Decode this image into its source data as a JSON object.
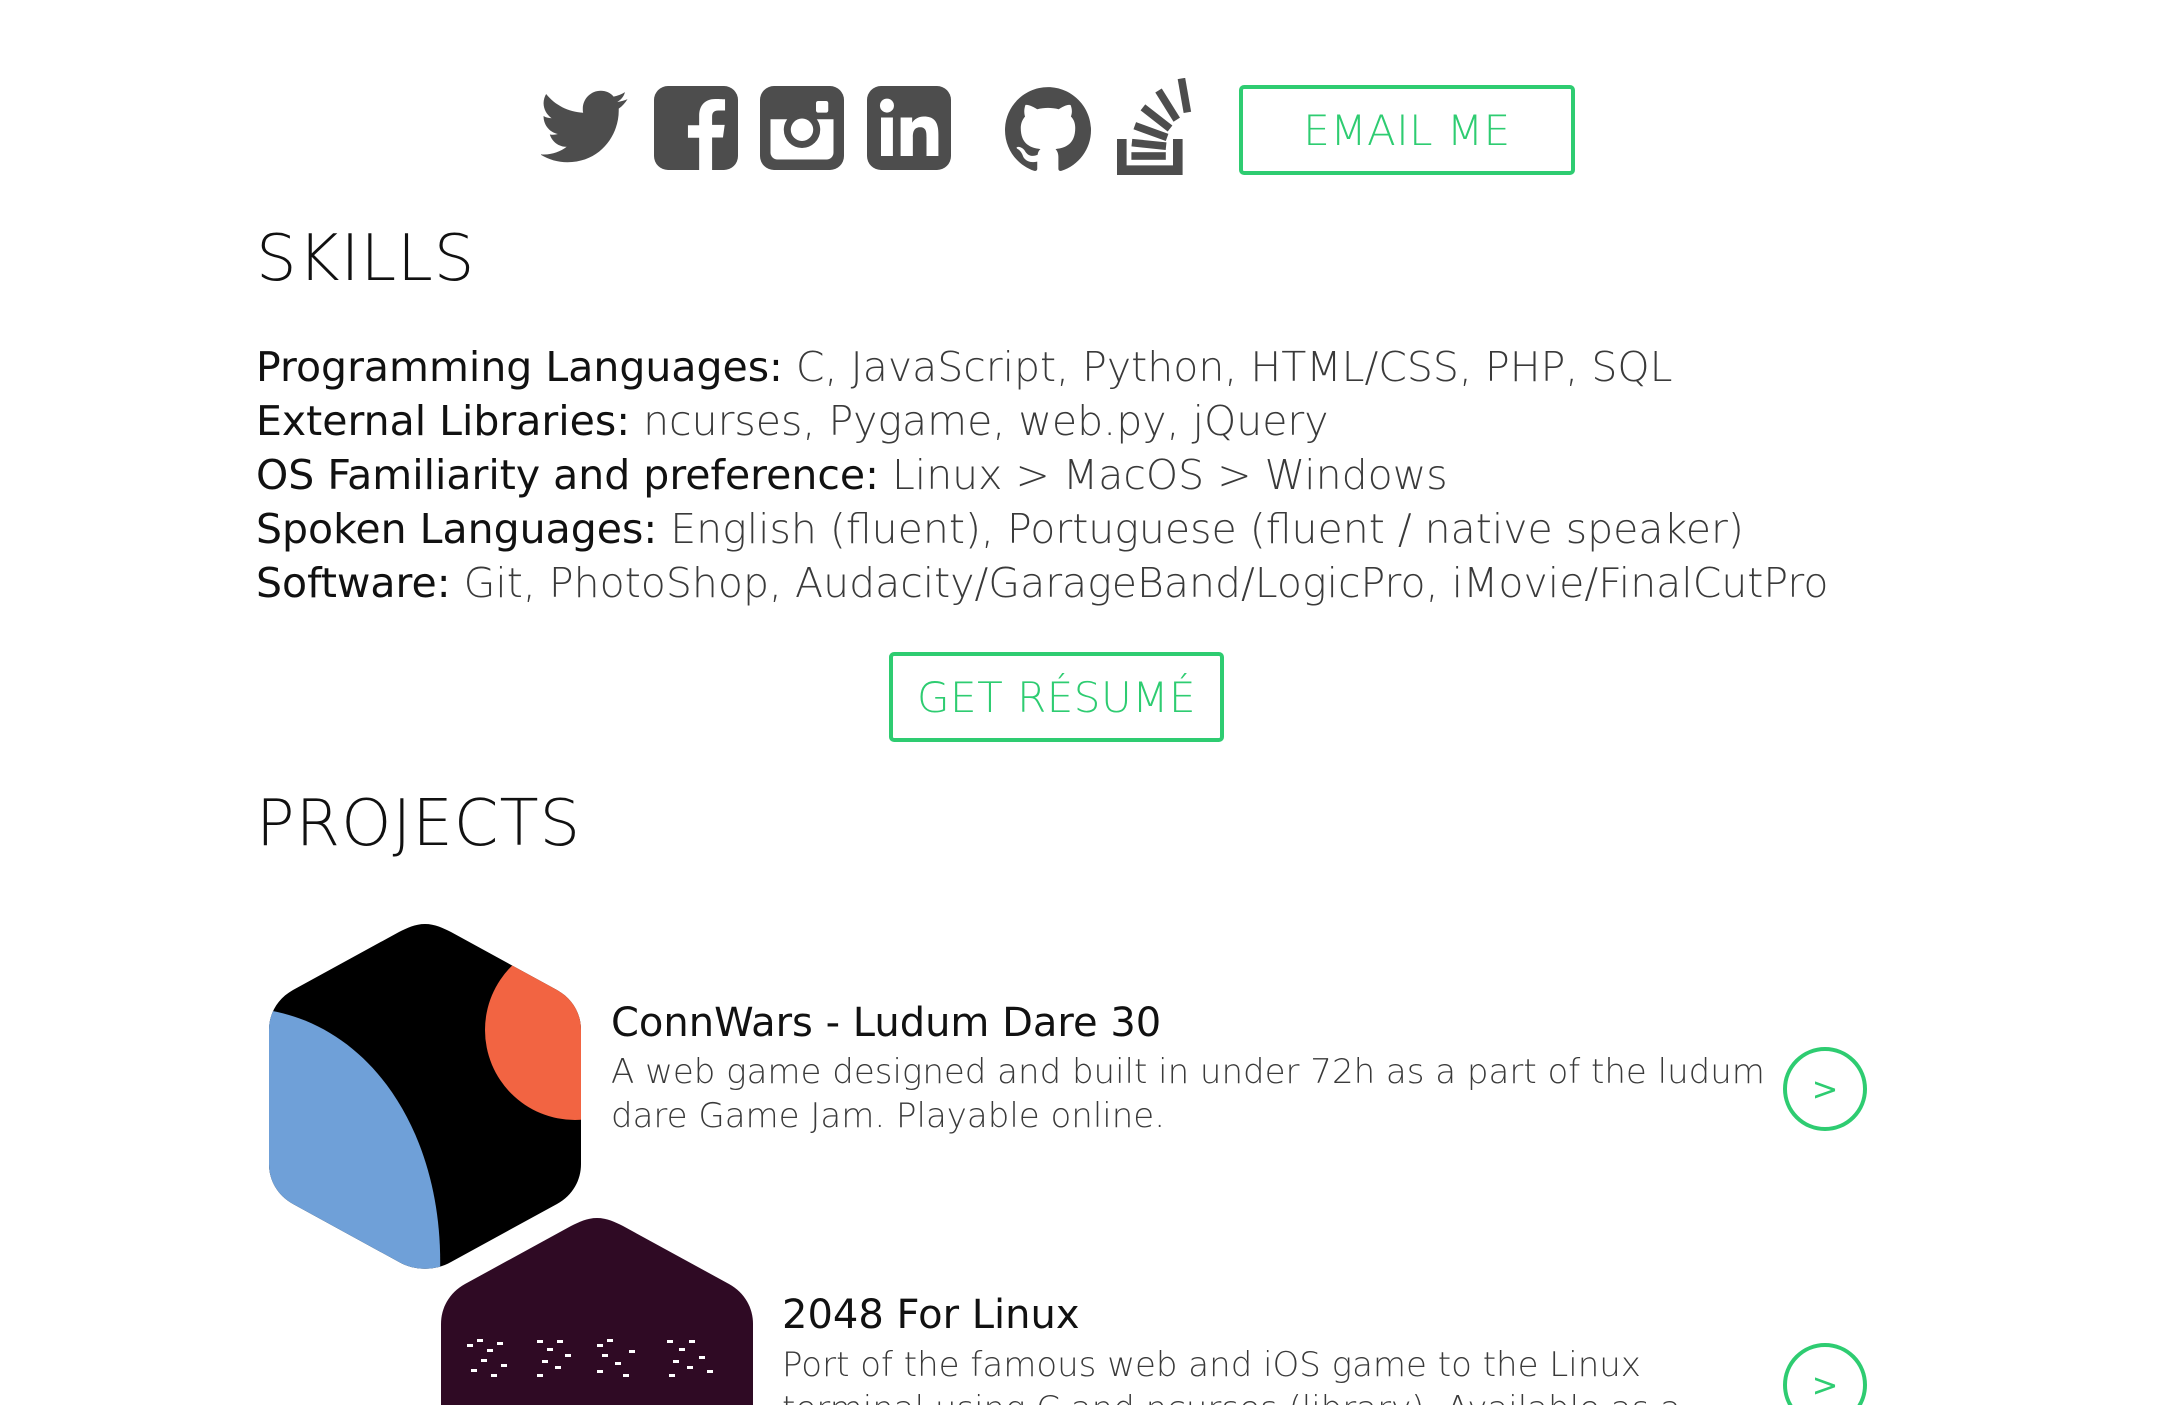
{
  "social": {
    "icons": [
      "twitter-icon",
      "facebook-icon",
      "instagram-icon",
      "linkedin-icon",
      "github-icon",
      "stackoverflow-icon"
    ],
    "icon_color": "#4d4d4d",
    "email_label": "EMAIL ME"
  },
  "accent_color": "#2ecc71",
  "skills": {
    "title": "SKILLS",
    "items": [
      {
        "label": "Programming Languages:",
        "value": " C, JavaScript, Python, HTML/CSS, PHP, SQL"
      },
      {
        "label": "External Libraries:",
        "value": " ncurses, Pygame, web.py, jQuery"
      },
      {
        "label": "OS Familiarity and preference:",
        "value": " Linux > MacOS > Windows"
      },
      {
        "label": "Spoken Languages:",
        "value": " English (fluent), Portuguese (fluent / native speaker)"
      },
      {
        "label": "Software:",
        "value": " Git, PhotoShop, Audacity/GarageBand/LogicPro, iMovie/FinalCutPro"
      }
    ],
    "resume_label": "GET RÉSUMÉ"
  },
  "projects": {
    "title": "PROJECTS",
    "items": [
      {
        "name": "ConnWars - Ludum Dare 30",
        "description": "A web game designed and built in under 72h as a part of the ludum dare Game Jam. Playable online.",
        "button_label": ">",
        "logo_colors": {
          "background": "#000000",
          "left": "#6fa0d8",
          "right": "#f26442"
        }
      },
      {
        "name": "2048 For Linux",
        "description": "Port of the famous web and iOS game to the Linux terminal using C and ncurses (library). Available as a ppa.",
        "button_label": ">",
        "logo_colors": {
          "background": "#2f0a24",
          "glyphs": "#ffffff"
        }
      }
    ]
  }
}
